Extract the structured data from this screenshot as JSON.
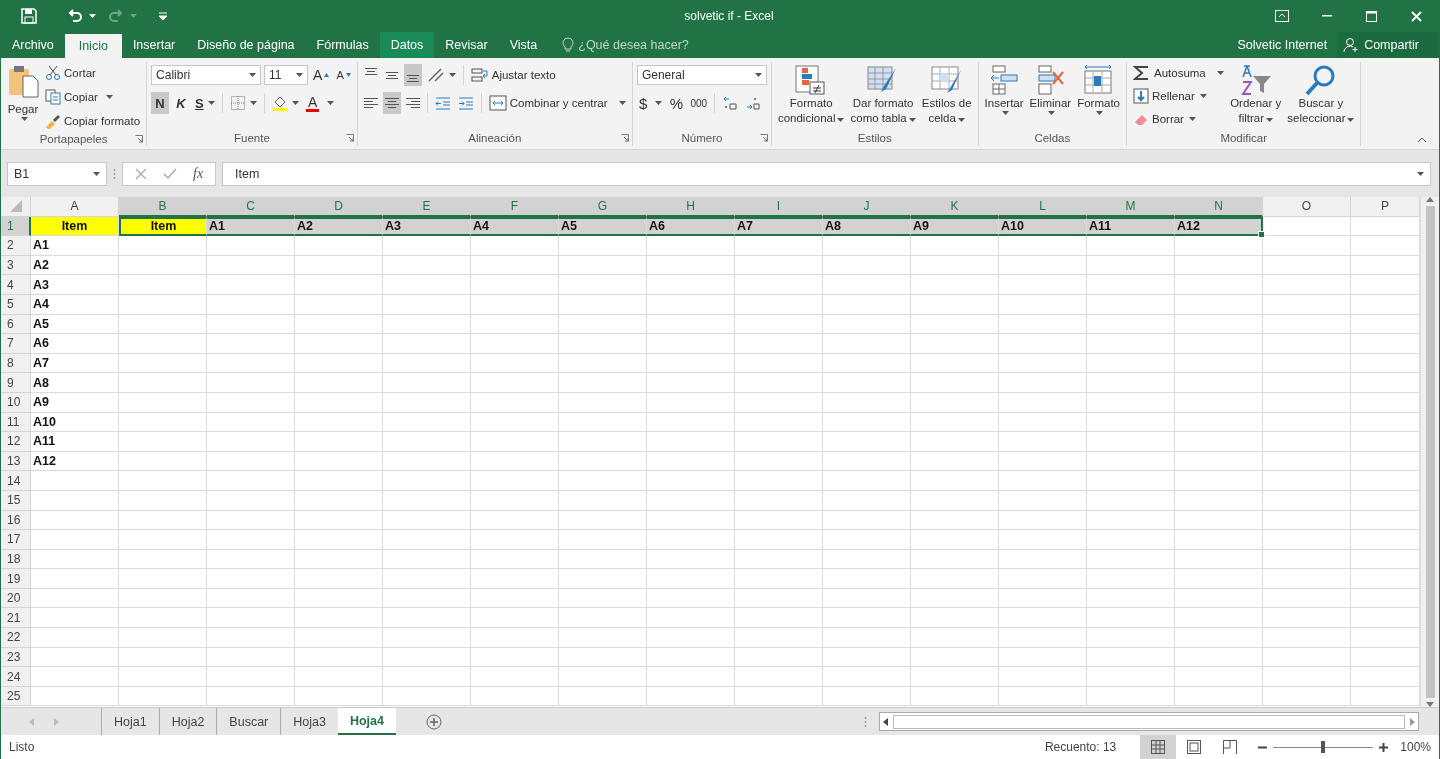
{
  "title_bar": {
    "title": "solvetic if - Excel"
  },
  "ribbon_tabs": [
    {
      "label": "Archivo",
      "selected": false,
      "highlighted": false
    },
    {
      "label": "Inicio",
      "selected": true,
      "highlighted": false
    },
    {
      "label": "Insertar",
      "selected": false,
      "highlighted": false
    },
    {
      "label": "Diseño de página",
      "selected": false,
      "highlighted": false
    },
    {
      "label": "Fórmulas",
      "selected": false,
      "highlighted": false
    },
    {
      "label": "Datos",
      "selected": false,
      "highlighted": true
    },
    {
      "label": "Revisar",
      "selected": false,
      "highlighted": false
    },
    {
      "label": "Vista",
      "selected": false,
      "highlighted": false
    }
  ],
  "tell_me": {
    "placeholder": "¿Qué desea hacer?"
  },
  "account": {
    "name": "Solvetic Internet"
  },
  "share_button": {
    "label": "Compartir"
  },
  "ribbon_groups": [
    {
      "kind": "clipboard",
      "label": "Portapapeles",
      "launcher": true,
      "items": [
        {
          "label": "Pegar"
        },
        {
          "label": "Cortar"
        },
        {
          "label": "Copiar"
        },
        {
          "label": "Copiar formato"
        }
      ]
    },
    {
      "kind": "font",
      "label": "Fuente",
      "launcher": true,
      "font_name": "Calibri",
      "font_size": "11",
      "grow_label": "A",
      "shrink_label": "A",
      "styles": [
        {
          "label": "N",
          "selected": true
        },
        {
          "label": "K",
          "selected": false
        },
        {
          "label": "S",
          "selected": false
        }
      ],
      "font_color_label": "A"
    },
    {
      "kind": "alignment",
      "label": "Alineación",
      "launcher": true,
      "vertical": [
        {
          "selected": false
        },
        {
          "selected": false
        },
        {
          "selected": true
        }
      ],
      "horizontal": [
        {
          "selected": false
        },
        {
          "selected": true
        },
        {
          "selected": false
        }
      ],
      "wrap_label": "Ajustar texto",
      "merge_label": "Combinar y centrar"
    },
    {
      "kind": "number",
      "label": "Número",
      "launcher": true,
      "format": "General",
      "currency": "$",
      "percent": "%",
      "thousands": "000"
    },
    {
      "kind": "large",
      "label": "Estilos",
      "launcher": false,
      "items": [
        {
          "lines": [
            "Formato",
            "condicional"
          ]
        },
        {
          "lines": [
            "Dar formato",
            "como tabla"
          ]
        },
        {
          "lines": [
            "Estilos de",
            "celda"
          ]
        }
      ]
    },
    {
      "kind": "large",
      "label": "Celdas",
      "launcher": false,
      "items": [
        {
          "lines": [
            "Insertar"
          ]
        },
        {
          "lines": [
            "Eliminar"
          ]
        },
        {
          "lines": [
            "Formato"
          ]
        }
      ]
    },
    {
      "kind": "modify",
      "label": "Modificar",
      "launcher": false,
      "items": [
        {
          "label": "Autosuma"
        },
        {
          "label": "Rellenar"
        },
        {
          "label": "Borrar"
        }
      ],
      "large": [
        {
          "lines": [
            "Ordenar y",
            "filtrar"
          ]
        },
        {
          "lines": [
            "Buscar y",
            "seleccionar"
          ]
        }
      ]
    }
  ],
  "formula_bar": {
    "name_box": "B1",
    "insert_function": "fx",
    "formula": "Item"
  },
  "sheet": {
    "columns": [
      {
        "label": "A",
        "selected": false
      },
      {
        "label": "B",
        "selected": true
      },
      {
        "label": "C",
        "selected": true
      },
      {
        "label": "D",
        "selected": true
      },
      {
        "label": "E",
        "selected": true
      },
      {
        "label": "F",
        "selected": true
      },
      {
        "label": "G",
        "selected": true
      },
      {
        "label": "H",
        "selected": true
      },
      {
        "label": "I",
        "selected": true
      },
      {
        "label": "J",
        "selected": true
      },
      {
        "label": "K",
        "selected": true
      },
      {
        "label": "L",
        "selected": true
      },
      {
        "label": "M",
        "selected": true
      },
      {
        "label": "N",
        "selected": true
      },
      {
        "label": "O",
        "selected": false
      },
      {
        "label": "P",
        "selected": false
      }
    ],
    "rows": [
      {
        "label": "1",
        "selected": true,
        "cells": [
          {
            "text": "Item",
            "color": "#ffff00",
            "centered": true,
            "selected": false
          },
          {
            "text": "Item",
            "color": "#ffff00",
            "centered": true,
            "selected": true,
            "active": true
          },
          {
            "text": "A1",
            "centered": false,
            "selected": true,
            "active": false
          },
          {
            "text": "A2",
            "centered": false,
            "selected": true,
            "active": false
          },
          {
            "text": "A3",
            "centered": false,
            "selected": true,
            "active": false
          },
          {
            "text": "A4",
            "centered": false,
            "selected": true,
            "active": false
          },
          {
            "text": "A5",
            "centered": false,
            "selected": true,
            "active": false
          },
          {
            "text": "A6",
            "centered": false,
            "selected": true,
            "active": false
          },
          {
            "text": "A7",
            "centered": false,
            "selected": true,
            "active": false
          },
          {
            "text": "A8",
            "centered": false,
            "selected": true,
            "active": false
          },
          {
            "text": "A9",
            "centered": false,
            "selected": true,
            "active": false
          },
          {
            "text": "A10",
            "centered": false,
            "selected": true,
            "active": false
          },
          {
            "text": "A11",
            "centered": false,
            "selected": true,
            "active": false
          },
          {
            "text": "A12",
            "centered": false,
            "selected": true,
            "active": false
          }
        ]
      },
      {
        "label": "2",
        "selected": false,
        "cells": [
          {
            "text": "A1",
            "selected": false
          }
        ]
      },
      {
        "label": "3",
        "selected": false,
        "cells": [
          {
            "text": "A2",
            "selected": false
          }
        ]
      },
      {
        "label": "4",
        "selected": false,
        "cells": [
          {
            "text": "A3",
            "selected": false
          }
        ]
      },
      {
        "label": "5",
        "selected": false,
        "cells": [
          {
            "text": "A4",
            "selected": false
          }
        ]
      },
      {
        "label": "6",
        "selected": false,
        "cells": [
          {
            "text": "A5",
            "selected": false
          }
        ]
      },
      {
        "label": "7",
        "selected": false,
        "cells": [
          {
            "text": "A6",
            "selected": false
          }
        ]
      },
      {
        "label": "8",
        "selected": false,
        "cells": [
          {
            "text": "A7",
            "selected": false
          }
        ]
      },
      {
        "label": "9",
        "selected": false,
        "cells": [
          {
            "text": "A8",
            "selected": false
          }
        ]
      },
      {
        "label": "10",
        "selected": false,
        "cells": [
          {
            "text": "A9",
            "selected": false
          }
        ]
      },
      {
        "label": "11",
        "selected": false,
        "cells": [
          {
            "text": "A10",
            "selected": false
          }
        ]
      },
      {
        "label": "12",
        "selected": false,
        "cells": [
          {
            "text": "A11",
            "selected": false
          }
        ]
      },
      {
        "label": "13",
        "selected": false,
        "cells": [
          {
            "text": "A12",
            "selected": false
          }
        ]
      },
      {
        "label": "14",
        "selected": false
      },
      {
        "label": "15",
        "selected": false
      },
      {
        "label": "16",
        "selected": false
      },
      {
        "label": "17",
        "selected": false
      },
      {
        "label": "18",
        "selected": false
      },
      {
        "label": "19",
        "selected": false
      },
      {
        "label": "20",
        "selected": false
      },
      {
        "label": "21",
        "selected": false
      },
      {
        "label": "22",
        "selected": false
      },
      {
        "label": "23",
        "selected": false
      },
      {
        "label": "24",
        "selected": false
      },
      {
        "label": "25",
        "selected": false
      }
    ]
  },
  "sheet_tabs": [
    {
      "label": "Hoja1",
      "selected": false
    },
    {
      "label": "Hoja2",
      "selected": false
    },
    {
      "label": "Buscar",
      "selected": false
    },
    {
      "label": "Hoja3",
      "selected": false
    },
    {
      "label": "Hoja4",
      "selected": true
    }
  ],
  "status_bar": {
    "status": "Listo",
    "count": "Recuento: 13",
    "views": [
      {
        "selected": true
      },
      {
        "selected": false
      },
      {
        "selected": false
      }
    ],
    "zoom": {
      "level": 0.5,
      "label": "100%"
    }
  }
}
